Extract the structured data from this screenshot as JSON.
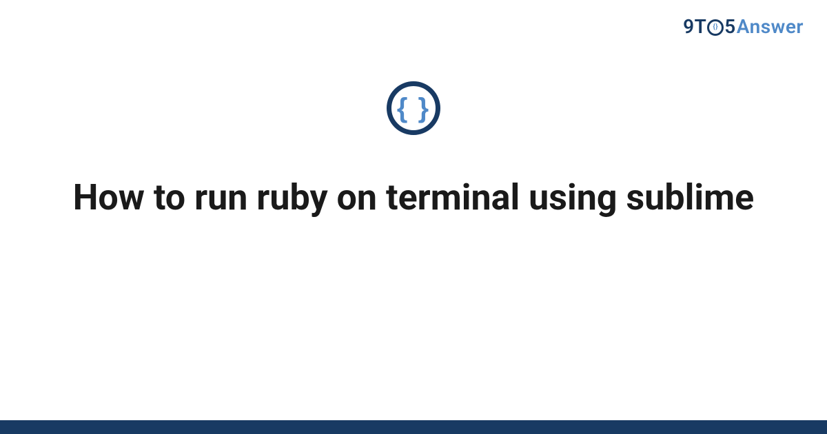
{
  "brand": {
    "part1": "9T",
    "part2": "5",
    "part3": "Answer",
    "icon_inner": "{}"
  },
  "topic_icon": {
    "glyph": "{ }"
  },
  "title": "How to run ruby on terminal using sublime",
  "colors": {
    "primary": "#183a63",
    "accent": "#4f89c8",
    "text": "#1a1a1a",
    "background": "#ffffff"
  }
}
